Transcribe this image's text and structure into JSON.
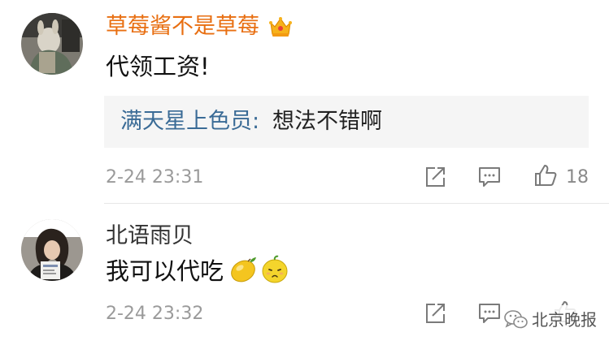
{
  "comments": [
    {
      "username": "草莓酱不是草莓",
      "text": "代领工资!",
      "reply": {
        "user": "满天星上色员:",
        "text": "想法不错啊"
      },
      "timestamp": "2-24 23:31",
      "like_count": "18",
      "icons": [
        "crown-icon",
        "share-icon",
        "comment-icon",
        "like-icon"
      ]
    },
    {
      "username": "北语雨贝",
      "text": "我可以代吃",
      "timestamp": "2-24 23:32",
      "like_count": "",
      "icons": [
        "lemon-emoji",
        "lemon-face-emoji",
        "share-icon",
        "comment-icon",
        "like-icon"
      ]
    }
  ],
  "watermark": {
    "text": "北京晚报",
    "icon": "wechat-icon"
  },
  "colors": {
    "username_vip": "#e86f12",
    "username": "#333333",
    "reply_user": "#3a6b96",
    "timestamp": "#9a9a9a",
    "reply_bg": "#f5f5f5"
  }
}
